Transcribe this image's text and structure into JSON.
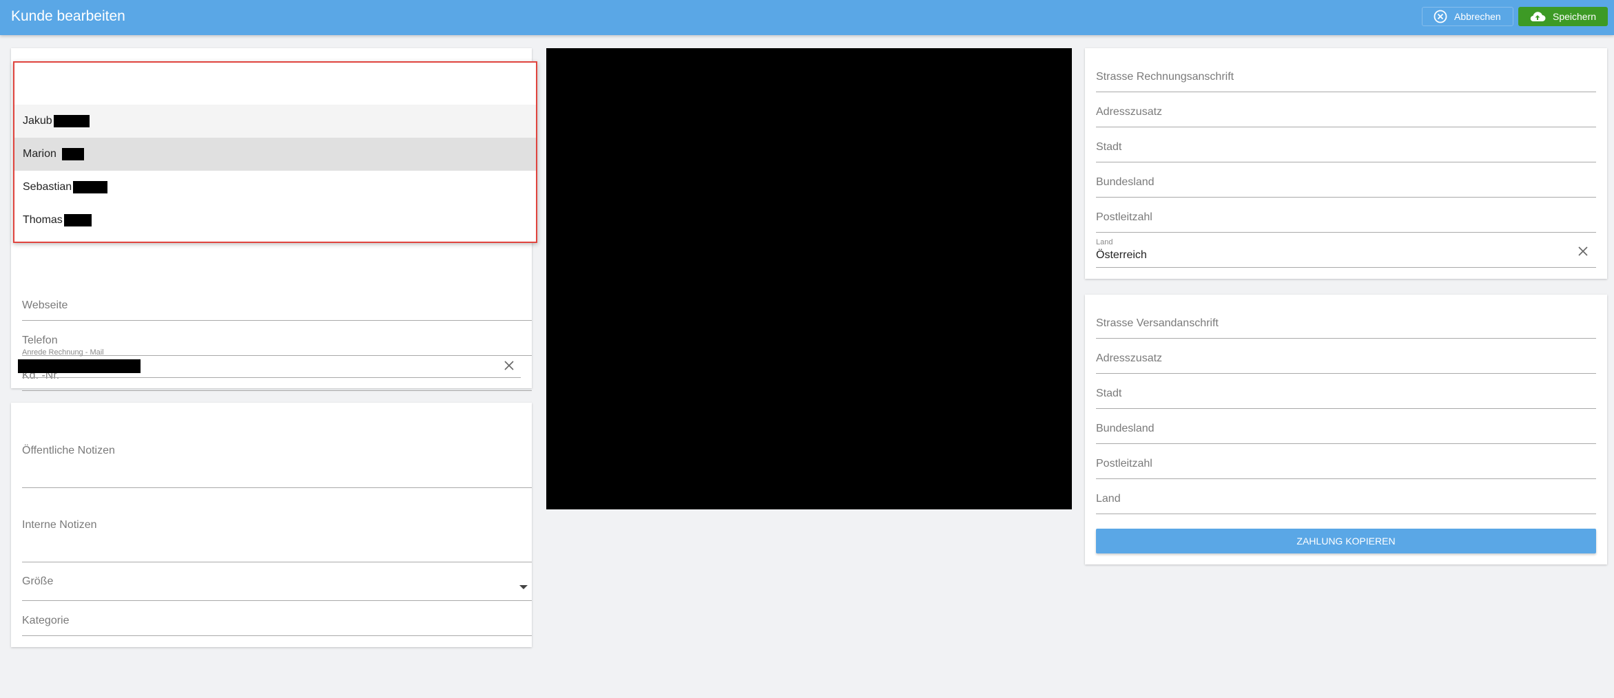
{
  "header": {
    "title": "Kunde bearbeiten",
    "cancel_label": "Abbrechen",
    "save_label": "Speichern"
  },
  "left_form": {
    "dropdown_options": [
      "Jakub",
      "Marion",
      "Sebastian",
      "Thomas"
    ],
    "website_label": "Webseite",
    "phone_label": "Telefon",
    "customer_no_label": "Kd. -Nr.",
    "salutation_label": "Anrede Rechnung - Mail"
  },
  "notes": {
    "public_label": "Öffentliche Notizen",
    "internal_label": "Interne Notizen",
    "size_label": "Größe",
    "category_label": "Kategorie"
  },
  "billing": {
    "street_label": "Strasse Rechnungsanschrift",
    "addition_label": "Adresszusatz",
    "city_label": "Stadt",
    "state_label": "Bundesland",
    "zip_label": "Postleitzahl",
    "country_label": "Land",
    "country_value": "Österreich"
  },
  "shipping": {
    "street_label": "Strasse Versandanschrift",
    "addition_label": "Adresszusatz",
    "city_label": "Stadt",
    "state_label": "Bundesland",
    "zip_label": "Postleitzahl",
    "country_label": "Land",
    "copy_button_label": "ZAHLUNG KOPIEREN"
  },
  "colors": {
    "header": "#5aa7e6",
    "save_button": "#3d9a25",
    "highlight_border": "#e0443e"
  }
}
